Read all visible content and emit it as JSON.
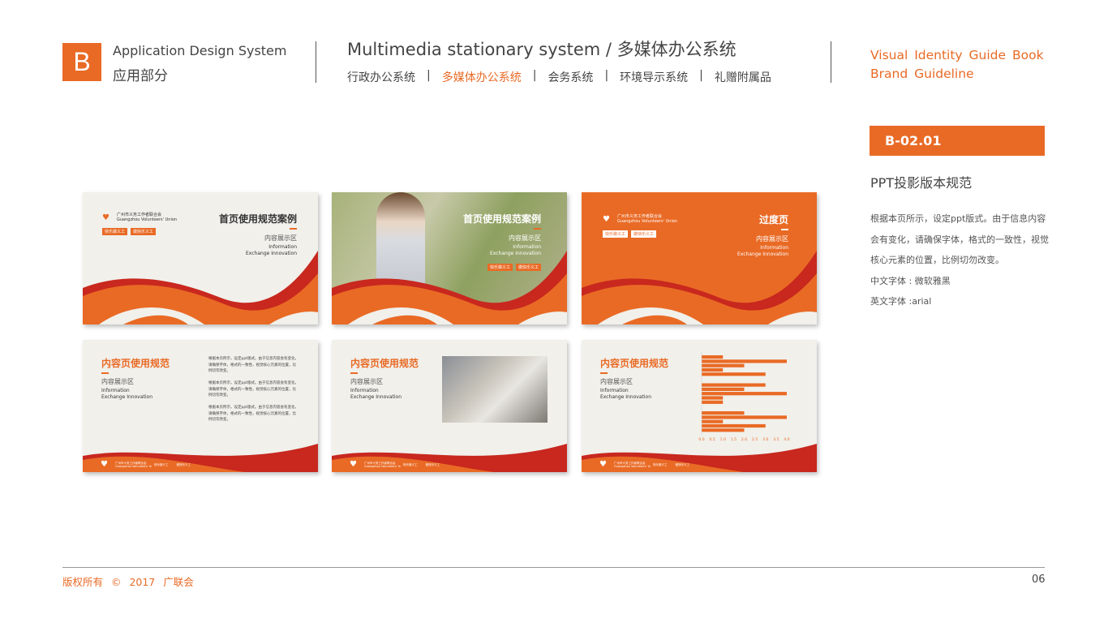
{
  "header": {
    "badge": "B",
    "section_en": "Application Design System",
    "section_cn": "应用部分",
    "system_title": "Multimedia stationary system  /  多媒体办公系统",
    "nav": [
      {
        "label": "行政办公系统",
        "active": false
      },
      {
        "label": "多媒体办公系统",
        "active": true
      },
      {
        "label": "会务系统",
        "active": false
      },
      {
        "label": "环境导示系统",
        "active": false
      },
      {
        "label": "礼赠附属品",
        "active": false
      }
    ],
    "nav_separator": "|",
    "vi_line1": "Visual Identity Guide Book",
    "vi_line2": "Brand Guideline"
  },
  "side": {
    "code": "B-02.01",
    "subtitle": "PPT投影版本规范",
    "description": "根据本页所示，设定ppt版式。由于信息内容会有变化，请确保字体，格式的一致性，视觉核心元素的位置，比例切勿改变。",
    "font_cn": "中文字体 : 微软雅黑",
    "font_en": "英文字体 :arial"
  },
  "slides": {
    "logo_cn": "广州市义务工作者联合会",
    "logo_en": "Guangzhou Volunteers' Union",
    "slogan1": "快乐做义工",
    "slogan2": "做快乐义工",
    "cover_title": "首页使用规范案例",
    "transition_title": "过度页",
    "content_title": "内容页使用规范",
    "sub": "内容展示区",
    "en1": "Information",
    "en2": "Exchange Innovation",
    "body_para": "根据本页所示，设定ppt版式。由于信息内容会有变化，请确保字体，格式的一致性，视觉核心元素的位置，比例切勿改变。"
  },
  "chart_data": {
    "type": "bar",
    "orientation": "horizontal",
    "groups": [
      [
        1,
        4,
        2,
        1,
        3
      ],
      [
        3,
        2,
        4,
        1,
        1
      ],
      [
        2,
        4,
        1,
        3,
        2
      ]
    ],
    "xlim": [
      0,
      4
    ],
    "xticks": [
      "0.0",
      "0.5",
      "1.0",
      "1.5",
      "2.0",
      "2.5",
      "3.0",
      "3.5",
      "4.0"
    ],
    "color": "#e96a25"
  },
  "footer": {
    "copyright": "版权所有 ©  2017  广联会",
    "page": "06"
  },
  "colors": {
    "accent": "#e96a25",
    "dark_red": "#c8281e"
  }
}
